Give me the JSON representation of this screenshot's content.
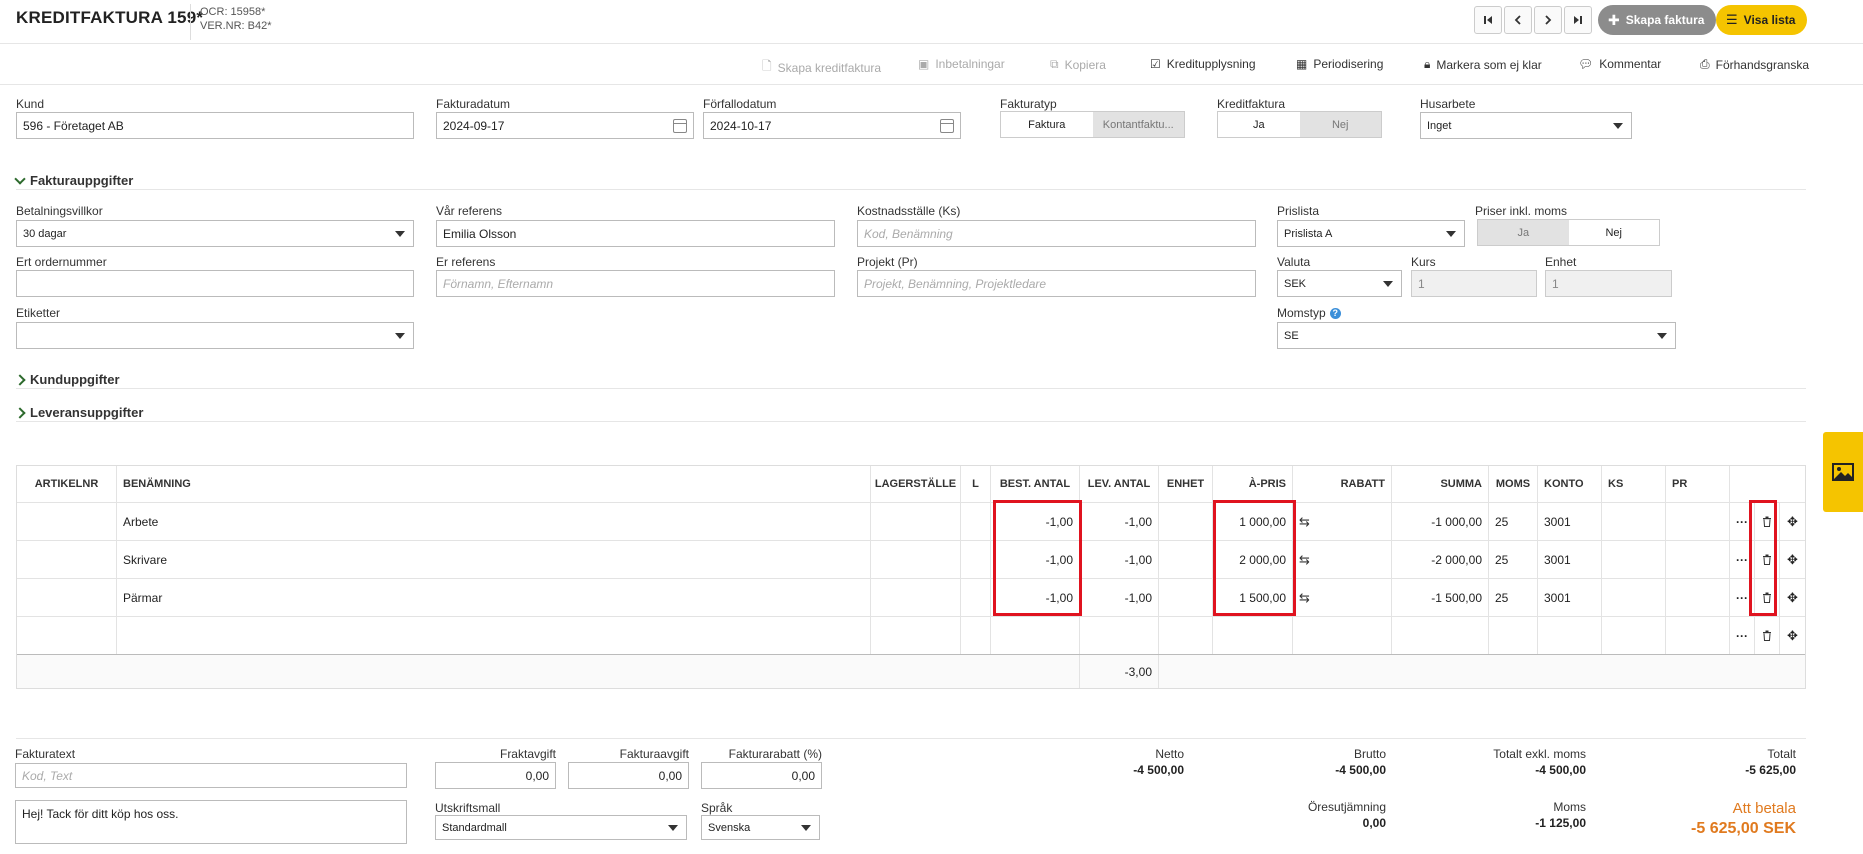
{
  "header": {
    "title": "KREDITFAKTURA 159*",
    "ocr": "OCR: 15958*",
    "vernr": "VER.NR: B42*",
    "nav": [
      "first",
      "prev",
      "next",
      "last"
    ],
    "create_label": "Skapa faktura",
    "list_label": "Visa lista"
  },
  "toolbar": {
    "create_credit": "Skapa kreditfaktura",
    "payments": "Inbetalningar",
    "copy": "Kopiera",
    "credit_info": "Kreditupplysning",
    "periodize": "Periodisering",
    "mark_unready": "Markera som ej klar",
    "comment": "Kommentar",
    "preview": "Förhandsgranska"
  },
  "form": {
    "kund_label": "Kund",
    "kund_value": "596 - Företaget AB",
    "fakturadatum_label": "Fakturadatum",
    "fakturadatum_value": "2024-09-17",
    "forfallodatum_label": "Förfallodatum",
    "forfallodatum_value": "2024-10-17",
    "fakturatyp_label": "Fakturatyp",
    "fakturatyp_options": [
      "Faktura",
      "Kontantfaktu..."
    ],
    "kreditfaktura_label": "Kreditfaktura",
    "kreditfaktura_options": [
      "Ja",
      "Nej"
    ],
    "husarbete_label": "Husarbete",
    "husarbete_value": "Inget"
  },
  "fakturauppgifter": {
    "title": "Fakturauppgifter",
    "betalningsvillkor_label": "Betalningsvillkor",
    "betalningsvillkor_value": "30 dagar",
    "var_referens_label": "Vår referens",
    "var_referens_value": "Emilia Olsson",
    "kostnadsstalle_label": "Kostnadsställe (Ks)",
    "kostnadsstalle_placeholder": "Kod, Benämning",
    "prislista_label": "Prislista",
    "prislista_value": "Prislista A",
    "priser_inkl_label": "Priser inkl. moms",
    "priser_inkl_options": [
      "Ja",
      "Nej"
    ],
    "ert_ordernummer_label": "Ert ordernummer",
    "er_referens_label": "Er referens",
    "er_referens_placeholder": "Förnamn, Efternamn",
    "projekt_label": "Projekt (Pr)",
    "projekt_placeholder": "Projekt, Benämning, Projektledare",
    "valuta_label": "Valuta",
    "valuta_value": "SEK",
    "kurs_label": "Kurs",
    "kurs_value": "1",
    "enhet_label": "Enhet",
    "enhet_value": "1",
    "etiketter_label": "Etiketter",
    "momstyp_label": "Momstyp",
    "momstyp_value": "SE"
  },
  "sections": {
    "kunduppgifter": "Kunduppgifter",
    "leveransuppgifter": "Leveransuppgifter"
  },
  "table": {
    "columns": [
      "ARTIKELNR",
      "BENÄMNING",
      "LAGERSTÄLLE",
      "L",
      "BEST. ANTAL",
      "LEV. ANTAL",
      "ENHET",
      "À-PRIS",
      "RABATT",
      "SUMMA",
      "MOMS",
      "KONTO",
      "KS",
      "PR"
    ],
    "rows": [
      {
        "benamning": "Arbete",
        "best": "-1,00",
        "lev": "-1,00",
        "apris": "1 000,00",
        "summa": "-1 000,00",
        "moms": "25",
        "konto": "3001"
      },
      {
        "benamning": "Skrivare",
        "best": "-1,00",
        "lev": "-1,00",
        "apris": "2 000,00",
        "summa": "-2 000,00",
        "moms": "25",
        "konto": "3001"
      },
      {
        "benamning": "Pärmar",
        "best": "-1,00",
        "lev": "-1,00",
        "apris": "1 500,00",
        "summa": "-1 500,00",
        "moms": "25",
        "konto": "3001"
      }
    ],
    "lev_total": "-3,00"
  },
  "footer": {
    "fakturatext_label": "Fakturatext",
    "fakturatext_placeholder": "Kod, Text",
    "message": "Hej! Tack för ditt köp hos oss.",
    "fraktavgift_label": "Fraktavgift",
    "fraktavgift_value": "0,00",
    "fakturaavgift_label": "Fakturaavgift",
    "fakturaavgift_value": "0,00",
    "fakturarabatt_label": "Fakturarabatt (%)",
    "fakturarabatt_value": "0,00",
    "utskriftsmall_label": "Utskriftsmall",
    "utskriftsmall_value": "Standardmall",
    "sprak_label": "Språk",
    "sprak_value": "Svenska",
    "netto_label": "Netto",
    "netto_value": "-4 500,00",
    "brutto_label": "Brutto",
    "brutto_value": "-4 500,00",
    "totalt_exkl_label": "Totalt exkl. moms",
    "totalt_exkl_value": "-4 500,00",
    "totalt_label": "Totalt",
    "totalt_value": "-5 625,00",
    "oresutjamning_label": "Öresutjämning",
    "oresutjamning_value": "0,00",
    "moms_label": "Moms",
    "moms_value": "-1 125,00",
    "att_betala_label": "Att betala",
    "att_betala_value": "-5 625,00 SEK"
  },
  "colors": {
    "accent_yellow": "#f5c400",
    "highlight_red": "#e0131f",
    "att_betala_orange": "#e07a1f",
    "section_chevron": "#2d6a2d"
  }
}
